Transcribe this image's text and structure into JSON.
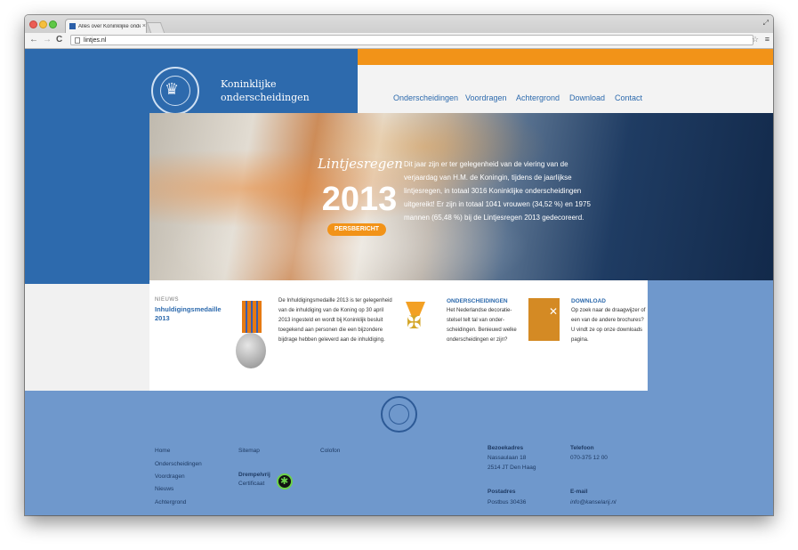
{
  "browser": {
    "tab_title": "Alles over Koninklijke onde",
    "tab_close": "×",
    "url": "lintjes.nl",
    "back": "←",
    "forward": "→",
    "reload": "C"
  },
  "header": {
    "brand_line1": "Koninklijke",
    "brand_line2": "onderscheidingen",
    "nav": [
      "Onderscheidingen",
      "Voordragen",
      "Achtergrond",
      "Download",
      "Contact"
    ],
    "search_placeholder": ""
  },
  "hero": {
    "title": "Lintjesregen",
    "year": "2013",
    "button": "PERSBERICHT",
    "text": "Dit jaar zijn er ter gelegenheid van de viering van de verjaardag van H.M. de Koningin, tijdens de jaarlijkse lintjesregen, in totaal 3016 Koninklijke onderscheidingen uitgereikt! Er zijn in totaal 1041 vrouwen (34,52 %) en 1975 mannen (65,48 %) bij de Lintjesregen 2013 gedecoreerd."
  },
  "content": {
    "news_label": "NIEUWS",
    "news_title": "Inhuldigingsmedaille 2013",
    "news_text": "De Inhuldigingsmedaille 2013 is ter gelegenheid van de inhuldiging van de Koning op 30 april 2013 ingesteld en wordt bij Koninklijk besluit toegekend aan personen die een bijzondere bijdrage hebben geleverd aan de inhuldiging.",
    "ond_title": "ONDERSCHEIDINGEN",
    "ond_text": "Het Nederlandse decoratie-stelsel telt tal van onder-scheidingen. Benieuwd welke onderscheidingen er zijn?",
    "dl_title": "DOWNLOAD",
    "dl_text": "Op zoek naar de draagwijzer of een van de andere brochures? U vindt ze op onze downloads pagina."
  },
  "footer": {
    "col1": [
      "Home",
      "Onderscheidingen",
      "Voordragen",
      "Nieuws",
      "Achtergrond"
    ],
    "sitemap": "Sitemap",
    "colofon": "Colofon",
    "drempelvrij": "Drempelvrij",
    "certificaat": "Certificaat",
    "bezoekadres_label": "Bezoekadres",
    "bezoekadres_1": "Nassaulaan 18",
    "bezoekadres_2": "2514 JT  Den Haag",
    "postadres_label": "Postadres",
    "postadres_1": "Postbus 30436",
    "telefoon_label": "Telefoon",
    "telefoon": "070-375 12 00",
    "email_label": "E-mail",
    "email": "info@kanselarij.nl"
  }
}
